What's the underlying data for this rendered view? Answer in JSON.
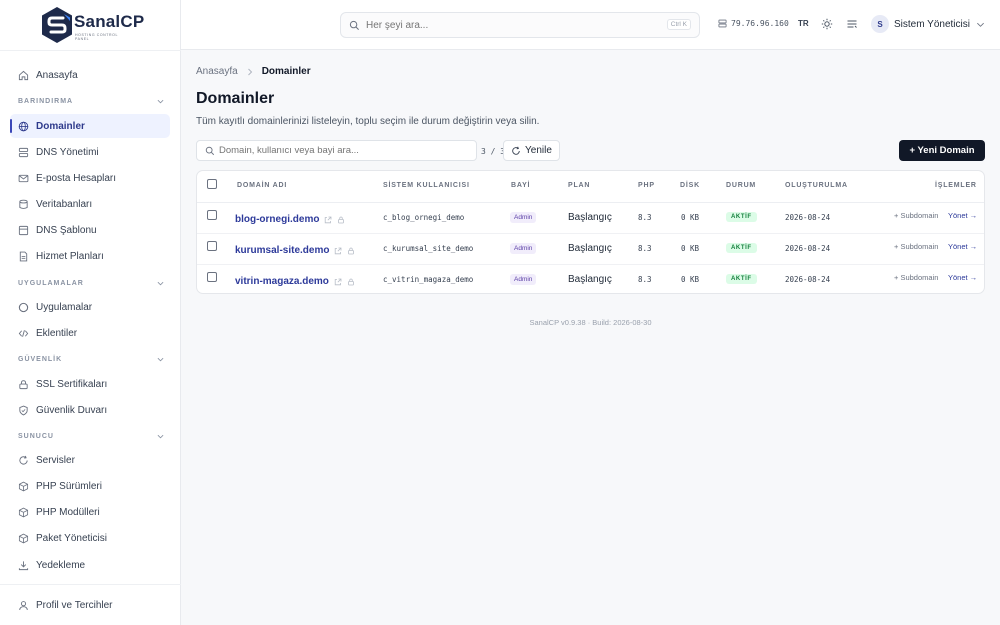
{
  "brand": {
    "name": "SanalCP",
    "subtitle": "HOSTING CONTROL PANEL",
    "accent": "#1e2a4a",
    "logo_secondary": "#3b82f6"
  },
  "sidebar": {
    "home": "Anasayfa",
    "sections": [
      {
        "title": "BARINDIRMA",
        "items": [
          "Domainler",
          "DNS Yönetimi",
          "E-posta Hesapları",
          "Veritabanları",
          "DNS Şablonu",
          "Hizmet Planları"
        ]
      },
      {
        "title": "UYGULAMALAR",
        "items": [
          "Uygulamalar",
          "Eklentiler"
        ]
      },
      {
        "title": "GÜVENLİK",
        "items": [
          "SSL Sertifikaları",
          "Güvenlik Duvarı"
        ]
      },
      {
        "title": "SUNUCU",
        "items": [
          "Servisler",
          "PHP Sürümleri",
          "PHP Modülleri",
          "Paket Yöneticisi",
          "Yedekleme"
        ]
      }
    ],
    "profile": "Profil ve Tercihler",
    "active": "Domainler"
  },
  "topbar": {
    "search_placeholder": "Her şeyi ara...",
    "shortcut": "Ctrl K",
    "ip": "79.76.96.160",
    "lang": "TR",
    "user_initial": "S",
    "user_name": "Sistem Yöneticisi"
  },
  "breadcrumb": {
    "home": "Anasayfa",
    "current": "Domainler"
  },
  "page": {
    "title": "Domainler",
    "description": "Tüm kayıtlı domainlerinizi listeleyin, toplu seçim ile durum değiştirin veya silin.",
    "search_placeholder": "Domain, kullanıcı veya bayi ara...",
    "count": "3 / 3",
    "refresh": "Yenile",
    "new_domain": "+ Yeni Domain"
  },
  "table": {
    "columns": [
      "DOMAİN ADI",
      "SİSTEM KULLANICISI",
      "BAYİ",
      "PLAN",
      "PHP",
      "DİSK",
      "DURUM",
      "OLUŞTURULMA",
      "İŞLEMLER"
    ],
    "rows": [
      {
        "domain": "blog-ornegi.demo",
        "user": "c_blog_ornegi_demo",
        "reseller": "Admin",
        "plan": "Başlangıç",
        "php": "8.3",
        "disk": "0 KB",
        "status": "AKTİF",
        "created": "2026-08-24",
        "sub": "+ Subdomain",
        "manage": "Yönet →"
      },
      {
        "domain": "kurumsal-site.demo",
        "user": "c_kurumsal_site_demo",
        "reseller": "Admin",
        "plan": "Başlangıç",
        "php": "8.3",
        "disk": "0 KB",
        "status": "AKTİF",
        "created": "2026-08-24",
        "sub": "+ Subdomain",
        "manage": "Yönet →"
      },
      {
        "domain": "vitrin-magaza.demo",
        "user": "c_vitrin_magaza_demo",
        "reseller": "Admin",
        "plan": "Başlangıç",
        "php": "8.3",
        "disk": "0 KB",
        "status": "AKTİF",
        "created": "2026-08-24",
        "sub": "+ Subdomain",
        "manage": "Yönet →"
      }
    ]
  },
  "footer": "SanalCP v0.9.38 · Build: 2026-08-30"
}
